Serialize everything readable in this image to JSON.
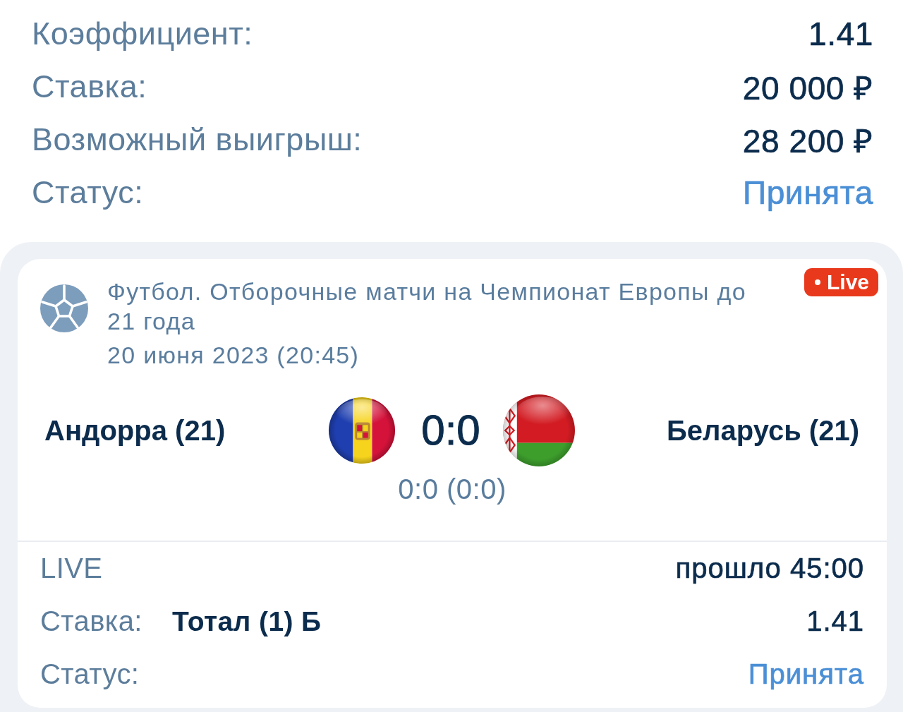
{
  "summary": [
    {
      "label": "Коэффициент:",
      "value": "1.41",
      "kind": "amount"
    },
    {
      "label": "Ставка:",
      "value": "20 000 ₽",
      "kind": "amount"
    },
    {
      "label": "Возможный выигрыш:",
      "value": "28 200 ₽",
      "kind": "amount"
    },
    {
      "label": "Статус:",
      "value": "Принята",
      "kind": "status"
    }
  ],
  "event": {
    "title": "Футбол. Отборочные матчи на Чемпионат Европы до 21 года",
    "datetime": "20 июня 2023 (20:45)",
    "badge": "Live",
    "home_team": "Андорра (21)",
    "away_team": "Беларусь (21)",
    "score": "0:0",
    "period_score": "0:0 (0:0)"
  },
  "details": [
    {
      "label": "LIVE",
      "value": "прошло 45:00",
      "kind": "timer"
    },
    {
      "label": "Ставка:",
      "selection": "Тотал (1) Б",
      "value": "1.41",
      "kind": "bet"
    },
    {
      "label": "Статус:",
      "value": "Принята",
      "kind": "status"
    }
  ]
}
